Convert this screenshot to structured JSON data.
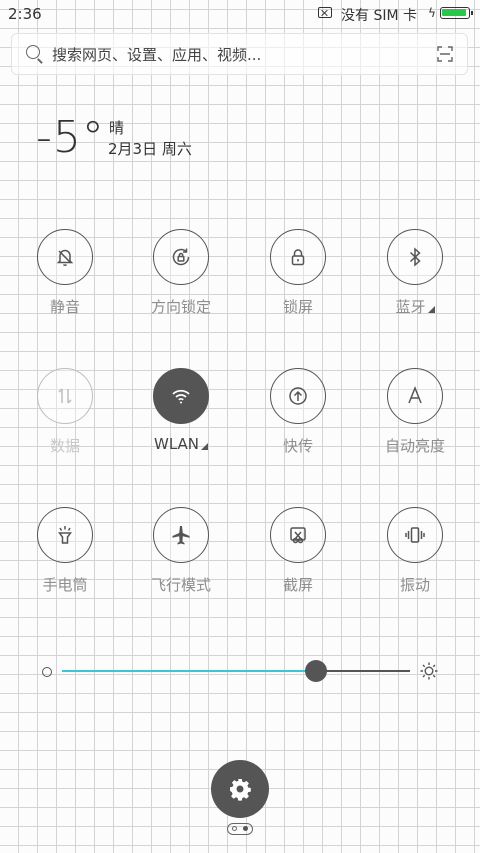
{
  "status_bar": {
    "time": "2:36",
    "sim_text": "没有 SIM 卡",
    "charging_icon": "lightning-icon",
    "battery_level": 0.95,
    "battery_color": "#2ac74a"
  },
  "search": {
    "placeholder": "搜索网页、设置、应用、视频..."
  },
  "weather": {
    "temperature": "-5°",
    "condition": "晴",
    "date": "2月3日 周六"
  },
  "toggles": [
    {
      "label": "静音",
      "icon": "bell-off-icon",
      "state": "off"
    },
    {
      "label": "方向锁定",
      "icon": "rotation-lock-icon",
      "state": "off"
    },
    {
      "label": "锁屏",
      "icon": "lock-icon",
      "state": "off"
    },
    {
      "label": "蓝牙",
      "icon": "bluetooth-icon",
      "state": "off",
      "has_more": true
    },
    {
      "label": "数据",
      "icon": "mobile-data-icon",
      "state": "disabled"
    },
    {
      "label": "WLAN",
      "icon": "wifi-icon",
      "state": "on",
      "has_more": true
    },
    {
      "label": "快传",
      "icon": "quick-transfer-icon",
      "state": "off"
    },
    {
      "label": "自动亮度",
      "icon": "auto-brightness-icon",
      "state": "off"
    },
    {
      "label": "手电筒",
      "icon": "flashlight-icon",
      "state": "off"
    },
    {
      "label": "飞行模式",
      "icon": "airplane-icon",
      "state": "off"
    },
    {
      "label": "截屏",
      "icon": "screenshot-icon",
      "state": "off"
    },
    {
      "label": "振动",
      "icon": "vibrate-icon",
      "state": "off"
    }
  ],
  "brightness": {
    "level": 0.73,
    "track_fill_color": "#3cc6d4"
  },
  "settings_icon": "gear-icon",
  "page_indicator": {
    "pages": 2,
    "current": 2
  },
  "colors": {
    "icon": "#555555",
    "label": "#8e8e8e",
    "active_fill": "#555555"
  }
}
